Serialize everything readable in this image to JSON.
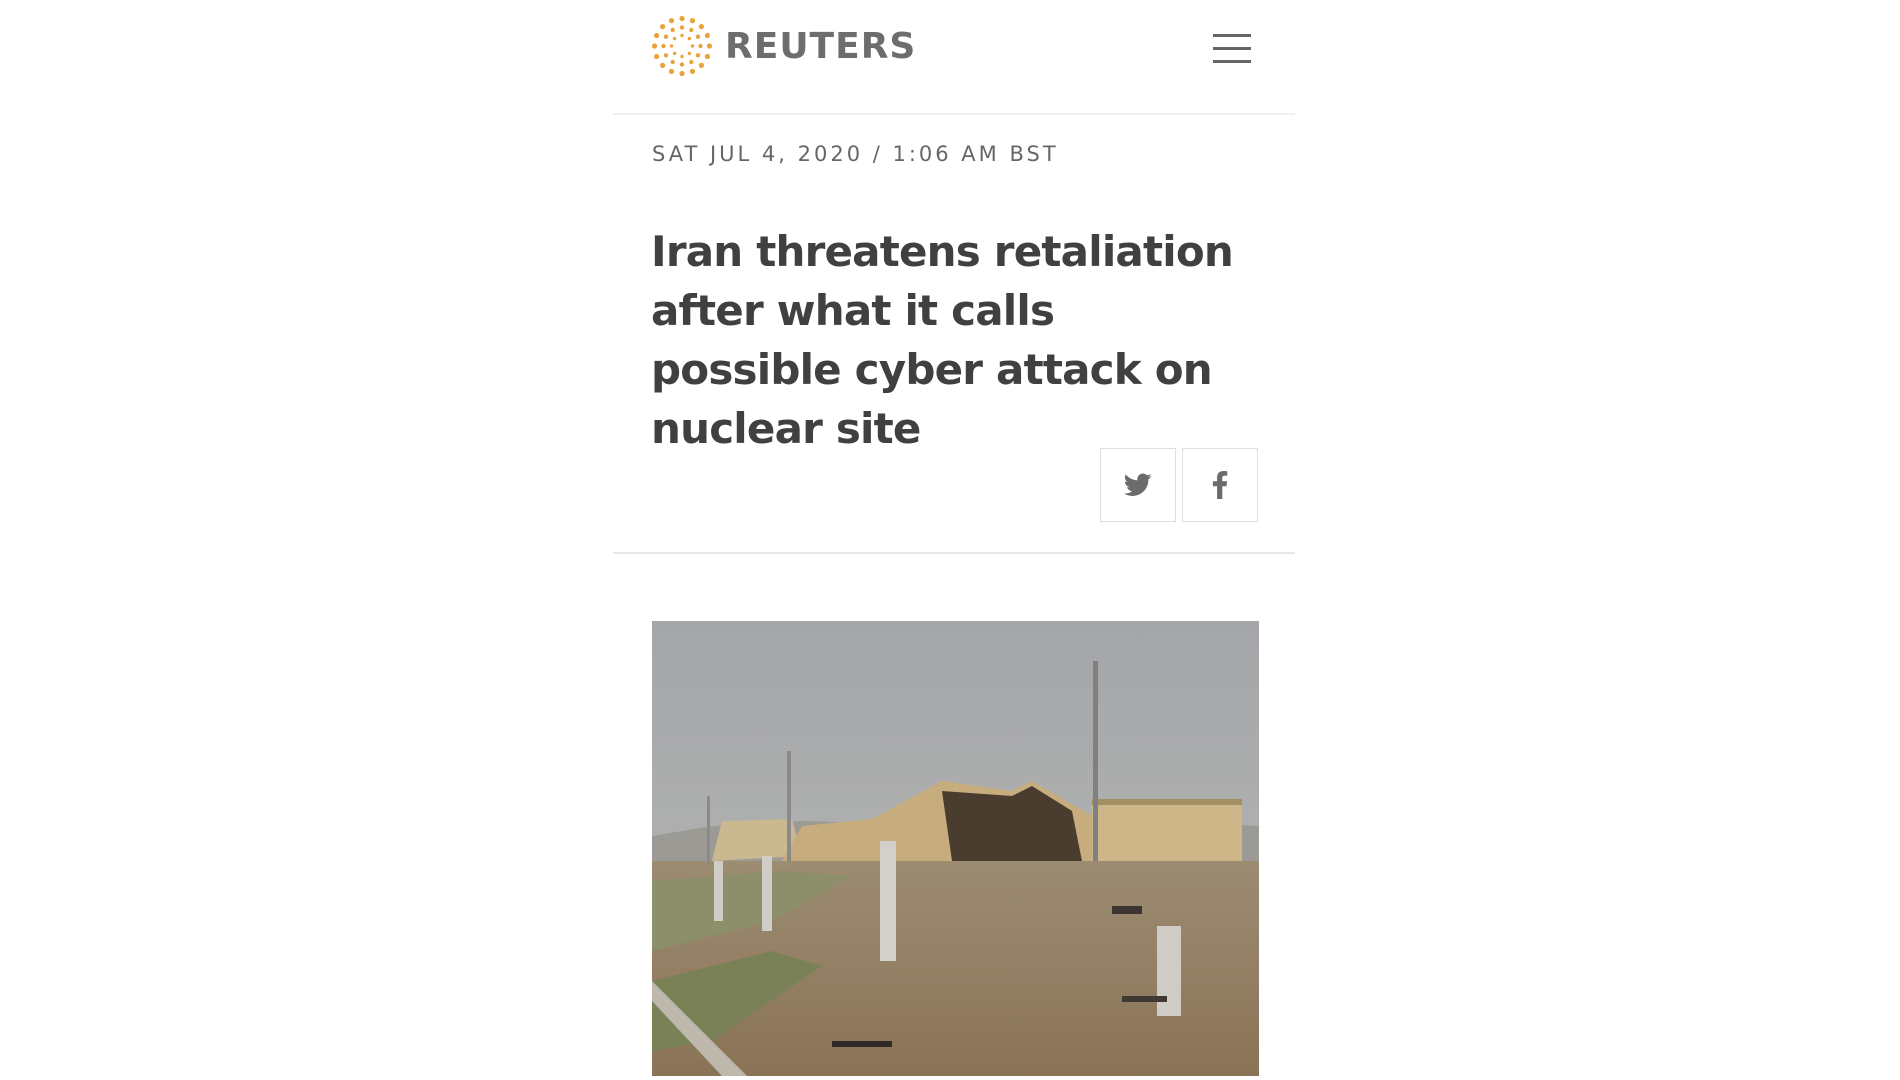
{
  "brand": {
    "name": "REUTERS",
    "logo_color": "#e8a33c",
    "text_color": "#6d6d6d"
  },
  "header": {
    "menu_icon": "hamburger-menu-icon"
  },
  "article": {
    "dateline": "SAT JUL 4, 2020 / 1:06 AM BST",
    "headline": "Iran threatens retaliation after what it calls possible cyber attack on nuclear site",
    "share": [
      {
        "icon": "twitter-icon"
      },
      {
        "icon": "facebook-icon"
      }
    ],
    "photo_subject": "damaged-building-photo"
  }
}
